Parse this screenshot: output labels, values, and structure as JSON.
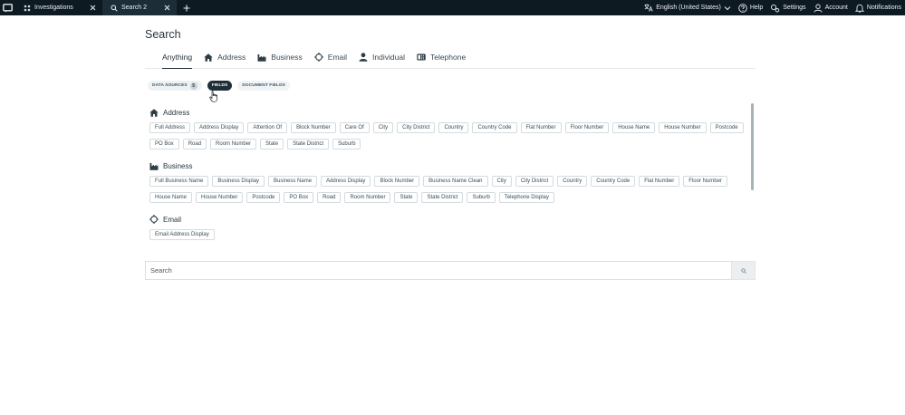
{
  "topbar": {
    "tabs": [
      {
        "label": "Investigations"
      },
      {
        "label": "Search 2"
      }
    ],
    "language": "English (United States)",
    "help": "Help",
    "settings": "Settings",
    "account": "Account",
    "notifications": "Notifications"
  },
  "page": {
    "title": "Search"
  },
  "type_tabs": [
    {
      "label": "Anything",
      "icon": "none"
    },
    {
      "label": "Address",
      "icon": "house-icon"
    },
    {
      "label": "Business",
      "icon": "factory-icon"
    },
    {
      "label": "Email",
      "icon": "email-target-icon"
    },
    {
      "label": "Individual",
      "icon": "person-icon"
    },
    {
      "label": "Telephone",
      "icon": "phone-icon"
    }
  ],
  "pills": {
    "data_sources": "DATA SOURCES",
    "data_sources_count": "5",
    "fields": "FIELDS",
    "document_fields": "DOCUMENT FIELDS"
  },
  "groups": {
    "address": {
      "title": "Address",
      "fields": [
        "Full Address",
        "Address Display",
        "Attention Of",
        "Block Number",
        "Care Of",
        "City",
        "City District",
        "Country",
        "Country Code",
        "Flat Number",
        "Floor Number",
        "House Name",
        "House Number",
        "Postcode",
        "PO Box",
        "Road",
        "Room Number",
        "State",
        "State District",
        "Suburb"
      ]
    },
    "business": {
      "title": "Business",
      "fields": [
        "Full Business Name",
        "Business Display",
        "Business Name",
        "Address Display",
        "Block Number",
        "Business Name Clean",
        "City",
        "City District",
        "Country",
        "Country Code",
        "Flat Number",
        "Floor Number",
        "House Name",
        "House Number",
        "Postcode",
        "PO Box",
        "Road",
        "Room Number",
        "State",
        "State District",
        "Suburb",
        "Telephone Display"
      ]
    },
    "email": {
      "title": "Email",
      "fields": [
        "Email Address Display"
      ]
    }
  },
  "search": {
    "placeholder": "Search"
  },
  "colors": {
    "topbar": "#0e1a22",
    "active_pill": "#1f2f38"
  }
}
